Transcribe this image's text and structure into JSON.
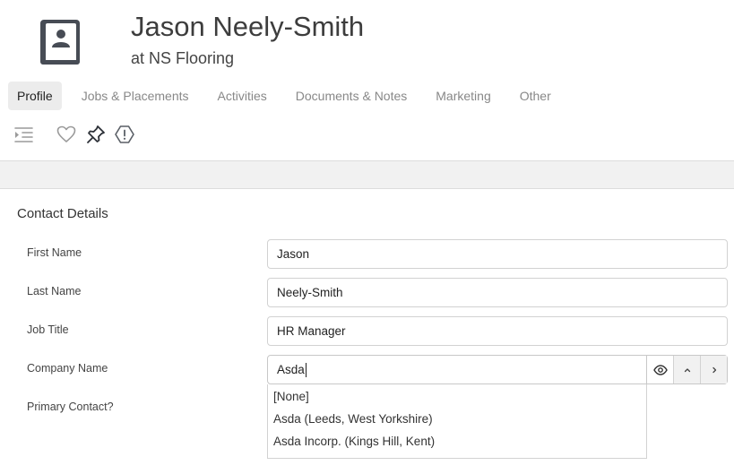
{
  "contact": {
    "name": "Jason Neely-Smith",
    "company_line": "at NS Flooring"
  },
  "tabs": [
    {
      "label": "Profile",
      "active": true
    },
    {
      "label": "Jobs & Placements",
      "active": false
    },
    {
      "label": "Activities",
      "active": false
    },
    {
      "label": "Documents & Notes",
      "active": false
    },
    {
      "label": "Marketing",
      "active": false
    },
    {
      "label": "Other",
      "active": false
    }
  ],
  "toolbar": {
    "icons": [
      "indent-list-icon",
      "heart-icon",
      "pin-icon",
      "alert-hexagon-icon"
    ]
  },
  "section": {
    "title": "Contact Details"
  },
  "fields": {
    "first_name": {
      "label": "First Name",
      "value": "Jason"
    },
    "last_name": {
      "label": "Last Name",
      "value": "Neely-Smith"
    },
    "job_title": {
      "label": "Job Title",
      "value": "HR Manager"
    },
    "company_name": {
      "label": "Company Name",
      "value": "Asda"
    },
    "primary_contact": {
      "label": "Primary Contact?"
    }
  },
  "company_dropdown": {
    "options": [
      "[None]",
      "Asda (Leeds, West Yorkshire)",
      "Asda Incorp. (Kings Hill, Kent)"
    ]
  },
  "colors": {
    "active_tab_bg": "#ececec",
    "icon_color": "#474c55",
    "muted_icon": "#9a9a9a"
  }
}
